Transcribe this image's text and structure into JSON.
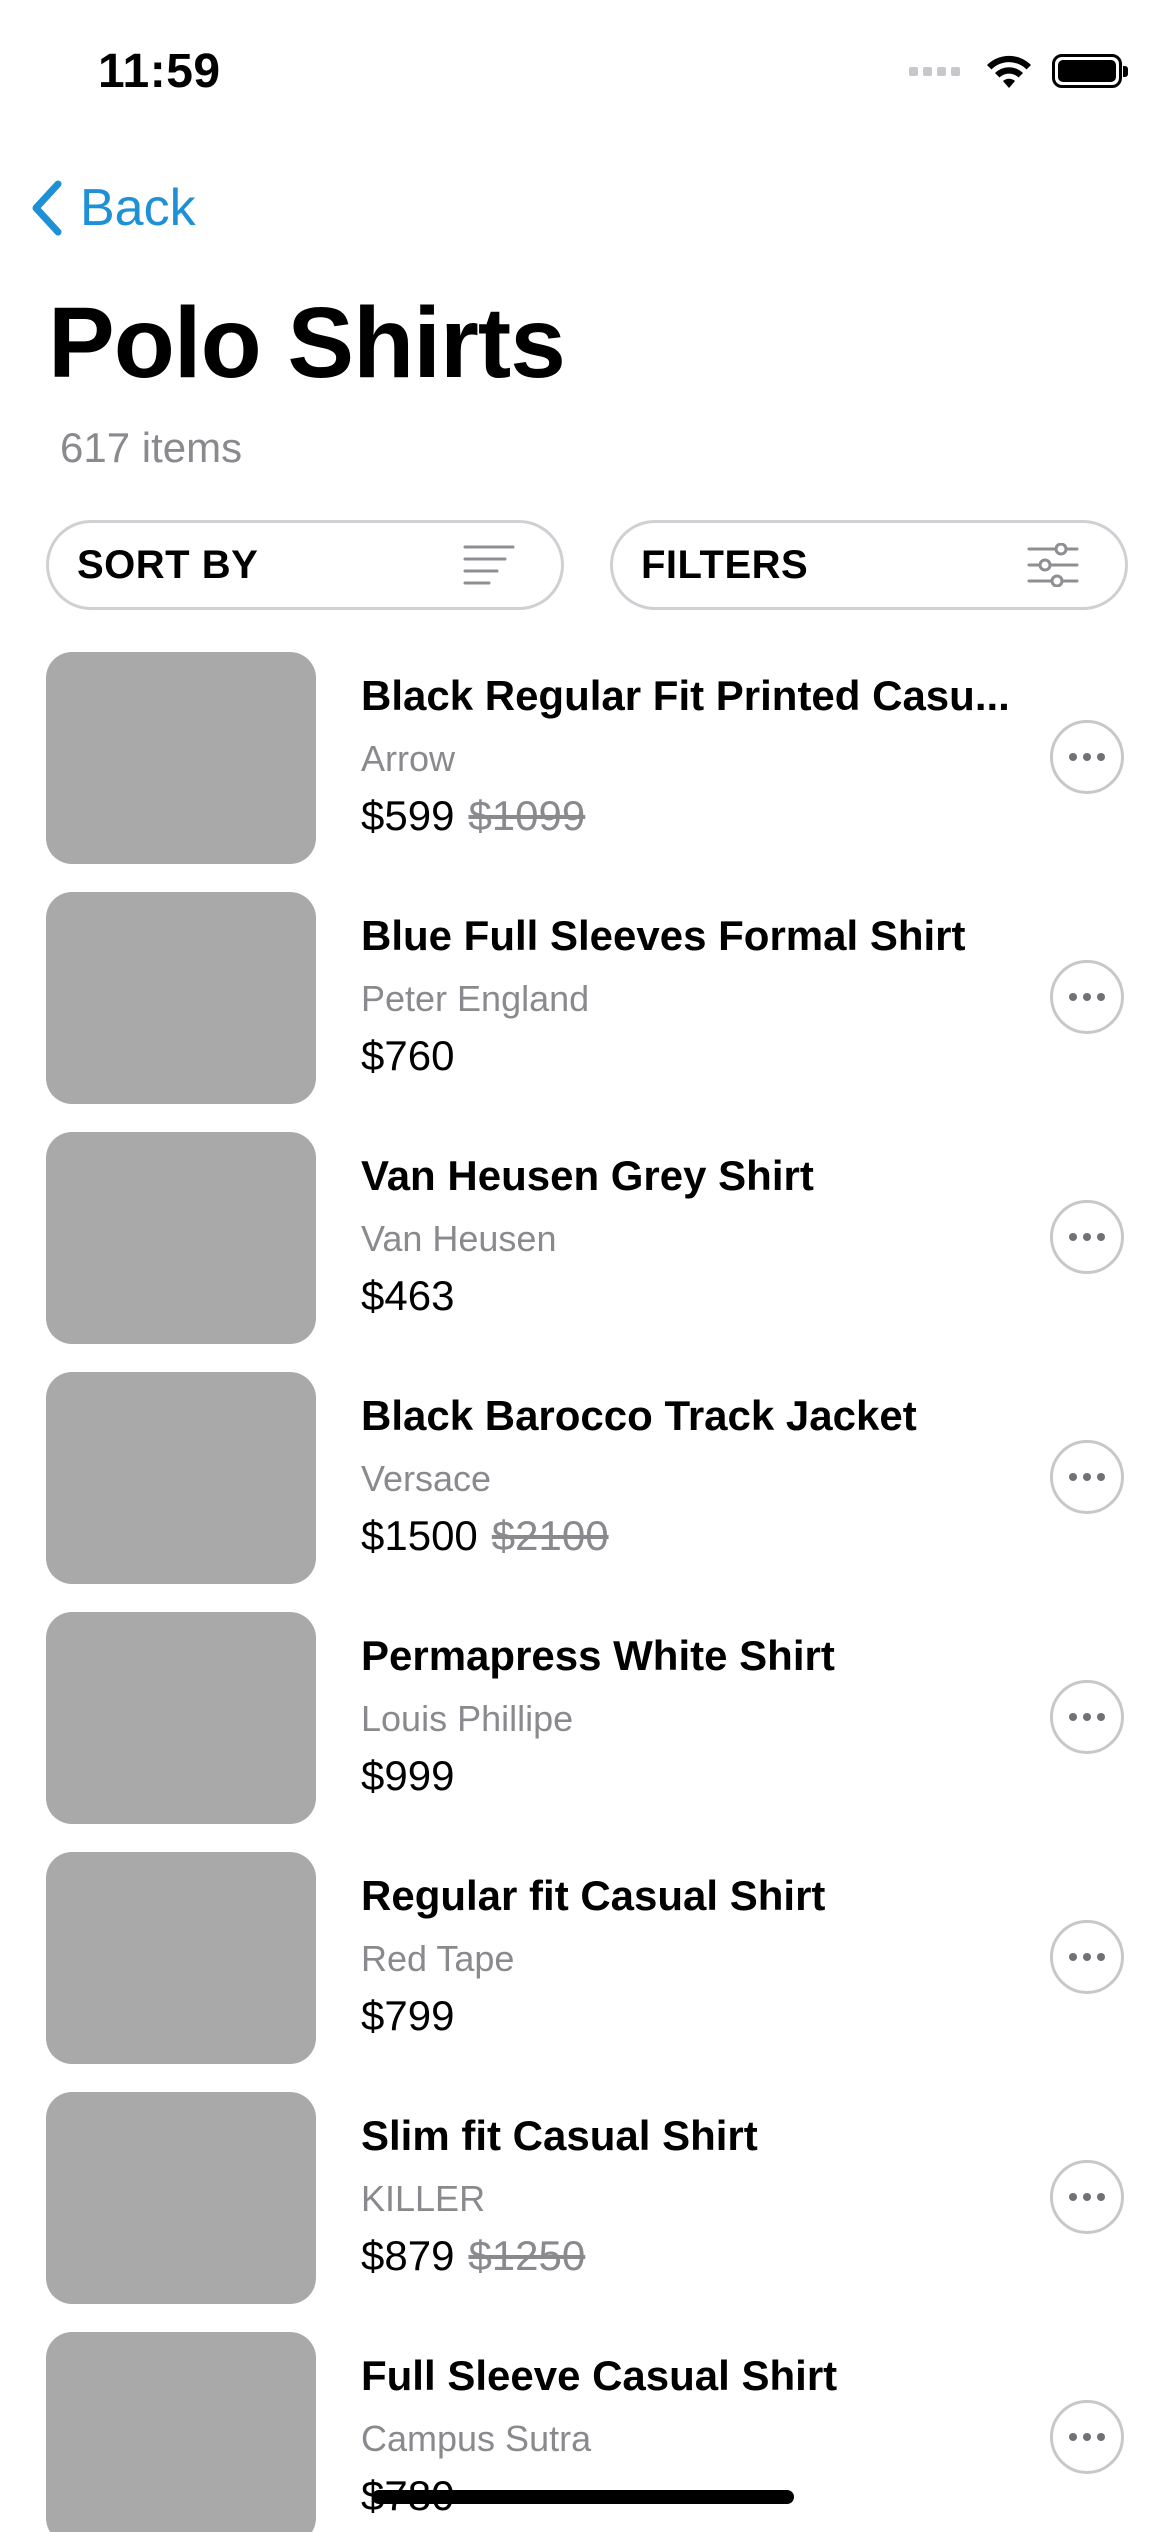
{
  "status_bar": {
    "time": "11:59",
    "icons": [
      "signal-icon",
      "wifi-icon",
      "battery-icon"
    ]
  },
  "nav": {
    "back_label": "Back",
    "accent_color": "#1e90d6"
  },
  "header": {
    "title": "Polo Shirts",
    "count": "617 items"
  },
  "controls": {
    "sort_label": "SORT BY",
    "filter_label": "FILTERS"
  },
  "products": [
    {
      "name": "Black Regular Fit Printed Casu...",
      "brand": "Arrow",
      "price": "$599",
      "old_price": "$1099"
    },
    {
      "name": "Blue Full Sleeves Formal Shirt",
      "brand": "Peter England",
      "price": "$760",
      "old_price": ""
    },
    {
      "name": "Van Heusen Grey Shirt",
      "brand": "Van Heusen",
      "price": "$463",
      "old_price": ""
    },
    {
      "name": "Black Barocco Track Jacket",
      "brand": "Versace",
      "price": "$1500",
      "old_price": "$2100"
    },
    {
      "name": "Permapress White Shirt",
      "brand": "Louis Phillipe",
      "price": "$999",
      "old_price": ""
    },
    {
      "name": "Regular fit Casual Shirt",
      "brand": "Red Tape",
      "price": "$799",
      "old_price": ""
    },
    {
      "name": "Slim fit Casual Shirt",
      "brand": "KILLER",
      "price": "$879",
      "old_price": "$1250"
    },
    {
      "name": "Full Sleeve Casual Shirt",
      "brand": "Campus Sutra",
      "price": "$780",
      "old_price": ""
    }
  ]
}
